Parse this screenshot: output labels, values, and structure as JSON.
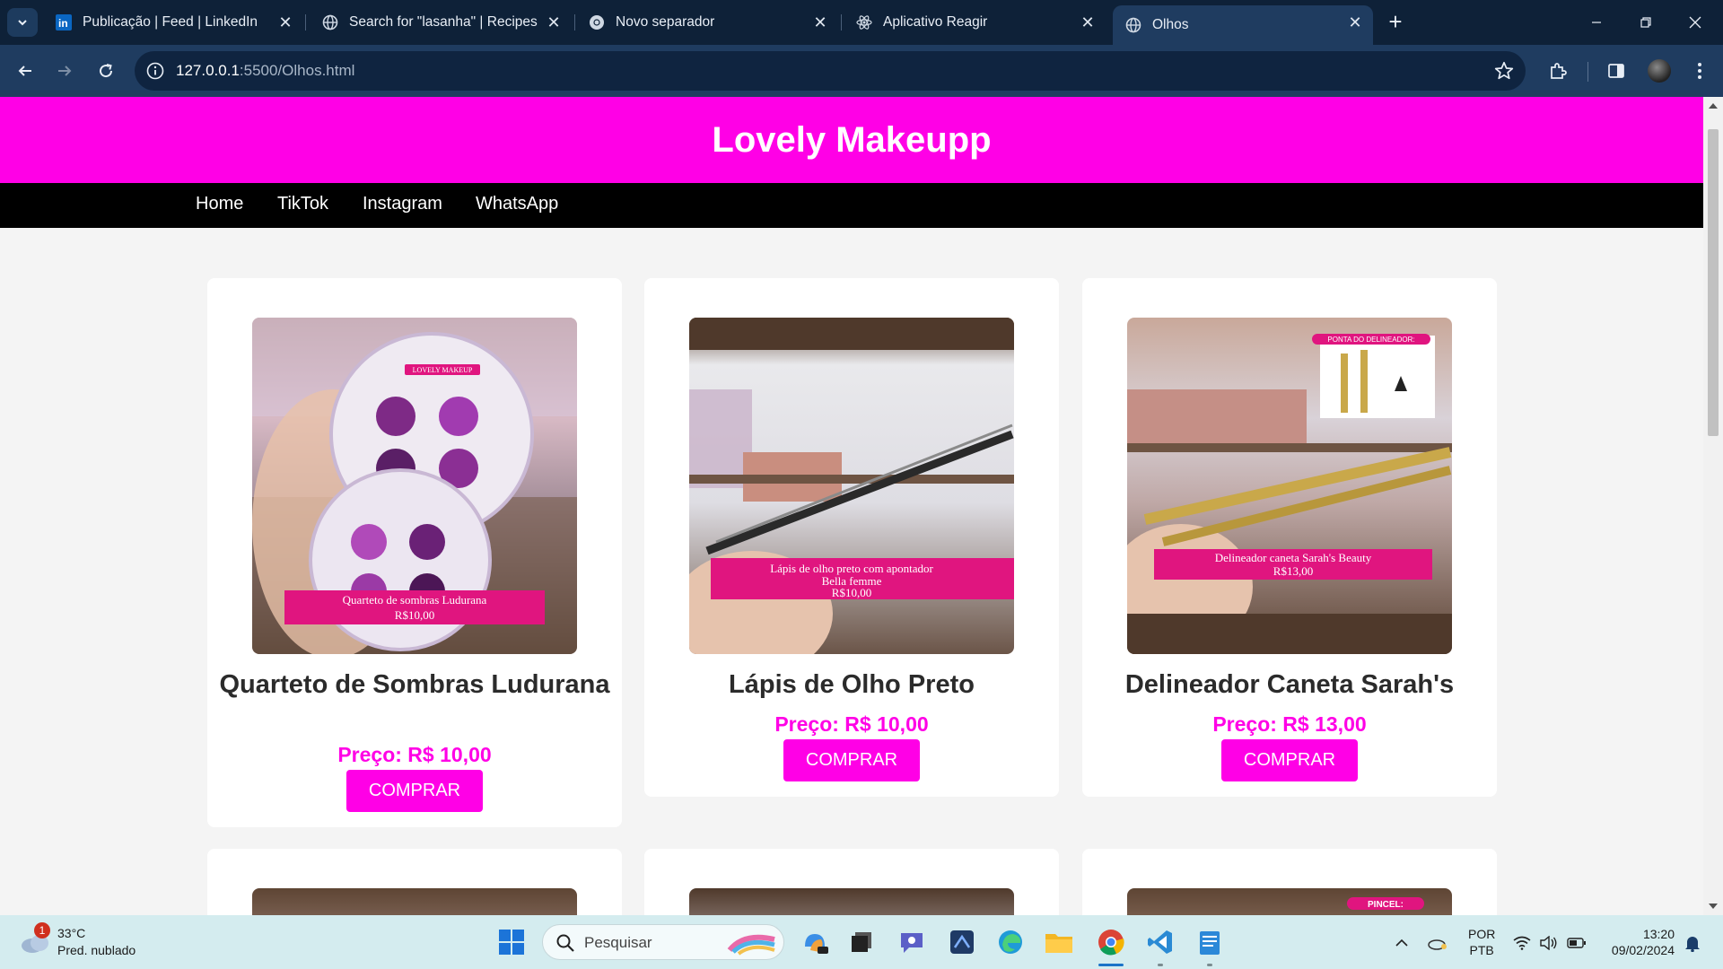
{
  "browser": {
    "tabs": [
      {
        "title": "Publicação | Feed | LinkedIn",
        "icon": "linkedin-icon"
      },
      {
        "title": "Search for \"lasanha\" | Recipes",
        "icon": "globe-icon"
      },
      {
        "title": "Novo separador",
        "icon": "chrome-icon"
      },
      {
        "title": "Aplicativo Reagir",
        "icon": "react-icon"
      },
      {
        "title": "Olhos",
        "icon": "globe-icon",
        "active": true
      }
    ],
    "url_host": "127.0.0.1",
    "url_rest": ":5500/Olhos.html"
  },
  "site": {
    "title": "Lovely Makeupp",
    "nav": [
      "Home",
      "TikTok",
      "Instagram",
      "WhatsApp"
    ],
    "accent_color": "#ff00e6"
  },
  "products": [
    {
      "name": "Quarteto de Sombras Ludurana",
      "price": "Preço: R$ 10,00",
      "button": "COMPRAR",
      "photo_brand": "LOVELY MAKEUP",
      "photo_caption": "Quarteto de sombras Ludurana",
      "photo_price": "R$10,00"
    },
    {
      "name": "Lápis de Olho Preto",
      "price": "Preço: R$ 10,00",
      "button": "COMPRAR",
      "photo_caption": "Lápis de olho preto com apontador",
      "photo_caption2": "Bella femme",
      "photo_price": "R$10,00"
    },
    {
      "name": "Delineador Caneta Sarah's",
      "price": "Preço: R$ 13,00",
      "button": "COMPRAR",
      "photo_tag": "PONTA DO DELINEADOR:",
      "photo_caption": "Delineador caneta Sarah's Beauty",
      "photo_price": "R$13,00"
    }
  ],
  "partial_row": {
    "photo_tag": "PINCEL:"
  },
  "taskbar": {
    "weather_badge": "1",
    "temperature": "33°C",
    "weather": "Pred. nublado",
    "search_placeholder": "Pesquisar",
    "lang_1": "POR",
    "lang_2": "PTB",
    "time": "13:20",
    "date": "09/02/2024"
  }
}
